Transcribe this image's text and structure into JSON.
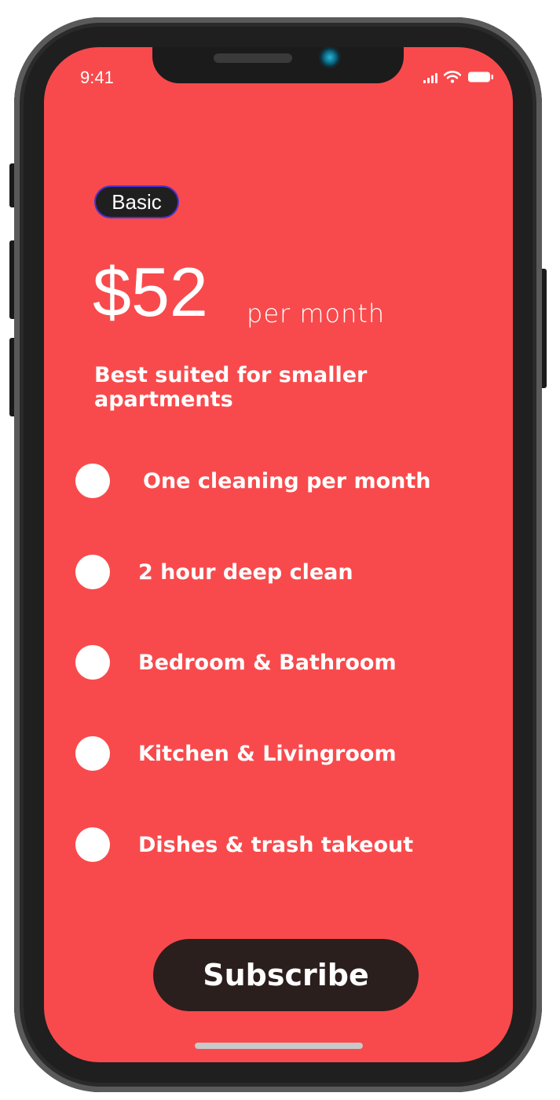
{
  "status_bar": {
    "time": "9:41",
    "icons": [
      "cellular-signal-icon",
      "wifi-icon",
      "battery-icon"
    ]
  },
  "plan": {
    "badge_label": "Basic",
    "price": "$52",
    "period": "per month",
    "description": "Best suited for smaller apartments"
  },
  "features": [
    {
      "label": " One cleaning per month"
    },
    {
      "label": "2 hour deep clean"
    },
    {
      "label": "Bedroom & Bathroom"
    },
    {
      "label": "Kitchen & Livingroom"
    },
    {
      "label": "Dishes & trash takeout"
    }
  ],
  "actions": {
    "subscribe_label": "Subscribe"
  },
  "colors": {
    "screen_background": "#f84a4c",
    "button_background": "#2b1f1e",
    "badge_background": "#1f1f1f",
    "badge_border": "#4b33c9",
    "text": "#ffffff"
  }
}
